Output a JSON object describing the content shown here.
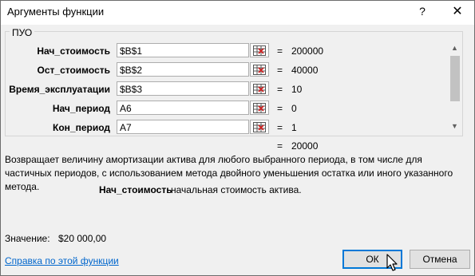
{
  "window": {
    "title": "Аргументы функции",
    "help_glyph": "?",
    "close_glyph": "✕"
  },
  "group": {
    "label": "ПУО"
  },
  "arguments": [
    {
      "label": "Нач_стоимость",
      "input": "$B$1",
      "value": "200000"
    },
    {
      "label": "Ост_стоимость",
      "input": "$B$2",
      "value": "40000"
    },
    {
      "label": "Время_эксплуатации",
      "input": "$B$3",
      "value": "10"
    },
    {
      "label": "Нач_период",
      "input": "A6",
      "value": "0"
    },
    {
      "label": "Кон_период",
      "input": "A7",
      "value": "1"
    }
  ],
  "equals": "=",
  "result": "20000",
  "description": "Возвращает величину амортизации актива для любого выбранного периода, в том числе для частичных периодов, с использованием метода двойного уменьшения остатка или иного указанного метода.",
  "current_arg": {
    "name": "Нач_стоимость",
    "text": "начальная стоимость актива."
  },
  "value_line": {
    "label": "Значение:",
    "amount": "$20 000,00"
  },
  "help_link": "Справка по этой функции",
  "buttons": {
    "ok": "ОК",
    "cancel": "Отмена"
  },
  "icons": {
    "ref": "range-select-icon",
    "scroll_up": "chevron-up-icon",
    "scroll_down": "chevron-down-icon",
    "cursor": "mouse-pointer-icon"
  }
}
